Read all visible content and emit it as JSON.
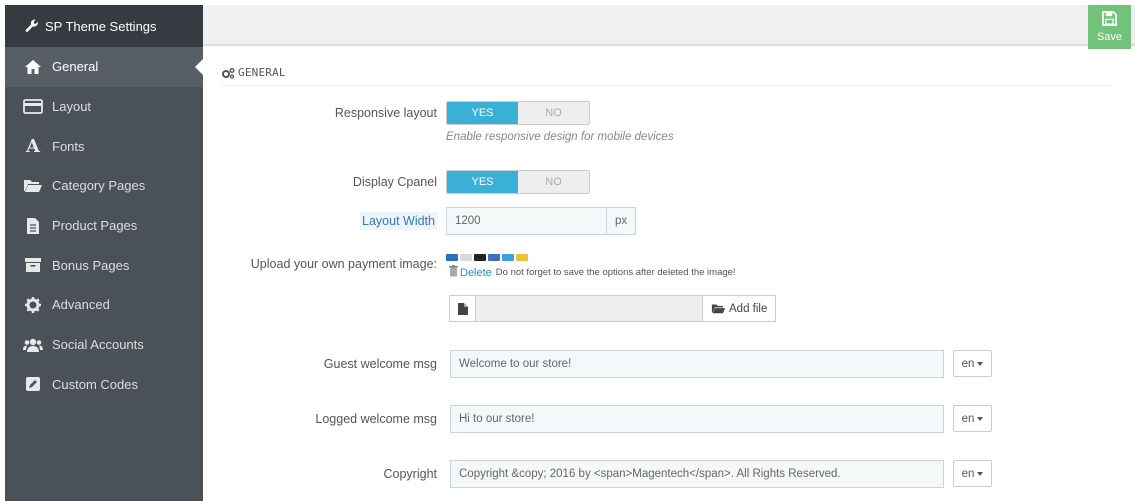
{
  "sidebar": {
    "title": "SP Theme Settings",
    "title_icon": "wrench-icon",
    "items": [
      {
        "label": "General",
        "icon": "home-icon",
        "active": true
      },
      {
        "label": "Layout",
        "icon": "credit-card-icon"
      },
      {
        "label": "Fonts",
        "icon": "font-icon"
      },
      {
        "label": "Category Pages",
        "icon": "folder-open-icon"
      },
      {
        "label": "Product Pages",
        "icon": "file-text-icon"
      },
      {
        "label": "Bonus Pages",
        "icon": "archive-icon"
      },
      {
        "label": "Advanced",
        "icon": "gear-icon"
      },
      {
        "label": "Social Accounts",
        "icon": "users-icon"
      },
      {
        "label": "Custom Codes",
        "icon": "pencil-icon"
      }
    ]
  },
  "toolbar": {
    "save_label": "Save",
    "save_color": "#72c279"
  },
  "panel": {
    "heading": "GENERAL",
    "heading_icon": "cogs-icon"
  },
  "form": {
    "responsive": {
      "label": "Responsive layout",
      "yes": "YES",
      "no": "NO",
      "value": "YES",
      "help": "Enable responsive design for mobile devices"
    },
    "cpanel": {
      "label": "Display Cpanel",
      "yes": "YES",
      "no": "NO",
      "value": "YES"
    },
    "layout_width": {
      "label": "Layout Width",
      "value": "1200",
      "unit": "px"
    },
    "payment": {
      "label": "Upload your own payment image:",
      "delete_label": "Delete",
      "delete_note": "Do not forget to save the options after deleted the image!",
      "add_file_label": "Add file"
    },
    "guest_msg": {
      "label": "Guest welcome msg",
      "value": "Welcome to our store!",
      "lang": "en"
    },
    "logged_msg": {
      "label": "Logged welcome msg",
      "value": "Hi to our store!",
      "lang": "en"
    },
    "copyright": {
      "label": "Copyright",
      "value": "Copyright &copy; 2016 by  <span>Magentech</span>. All Rights Reserved.",
      "lang": "en"
    }
  },
  "colors": {
    "accent": "#3bb0d6",
    "sidebar_bg": "#4b5158",
    "sidebar_header_bg": "#363a41",
    "link": "#2a8fbd"
  }
}
